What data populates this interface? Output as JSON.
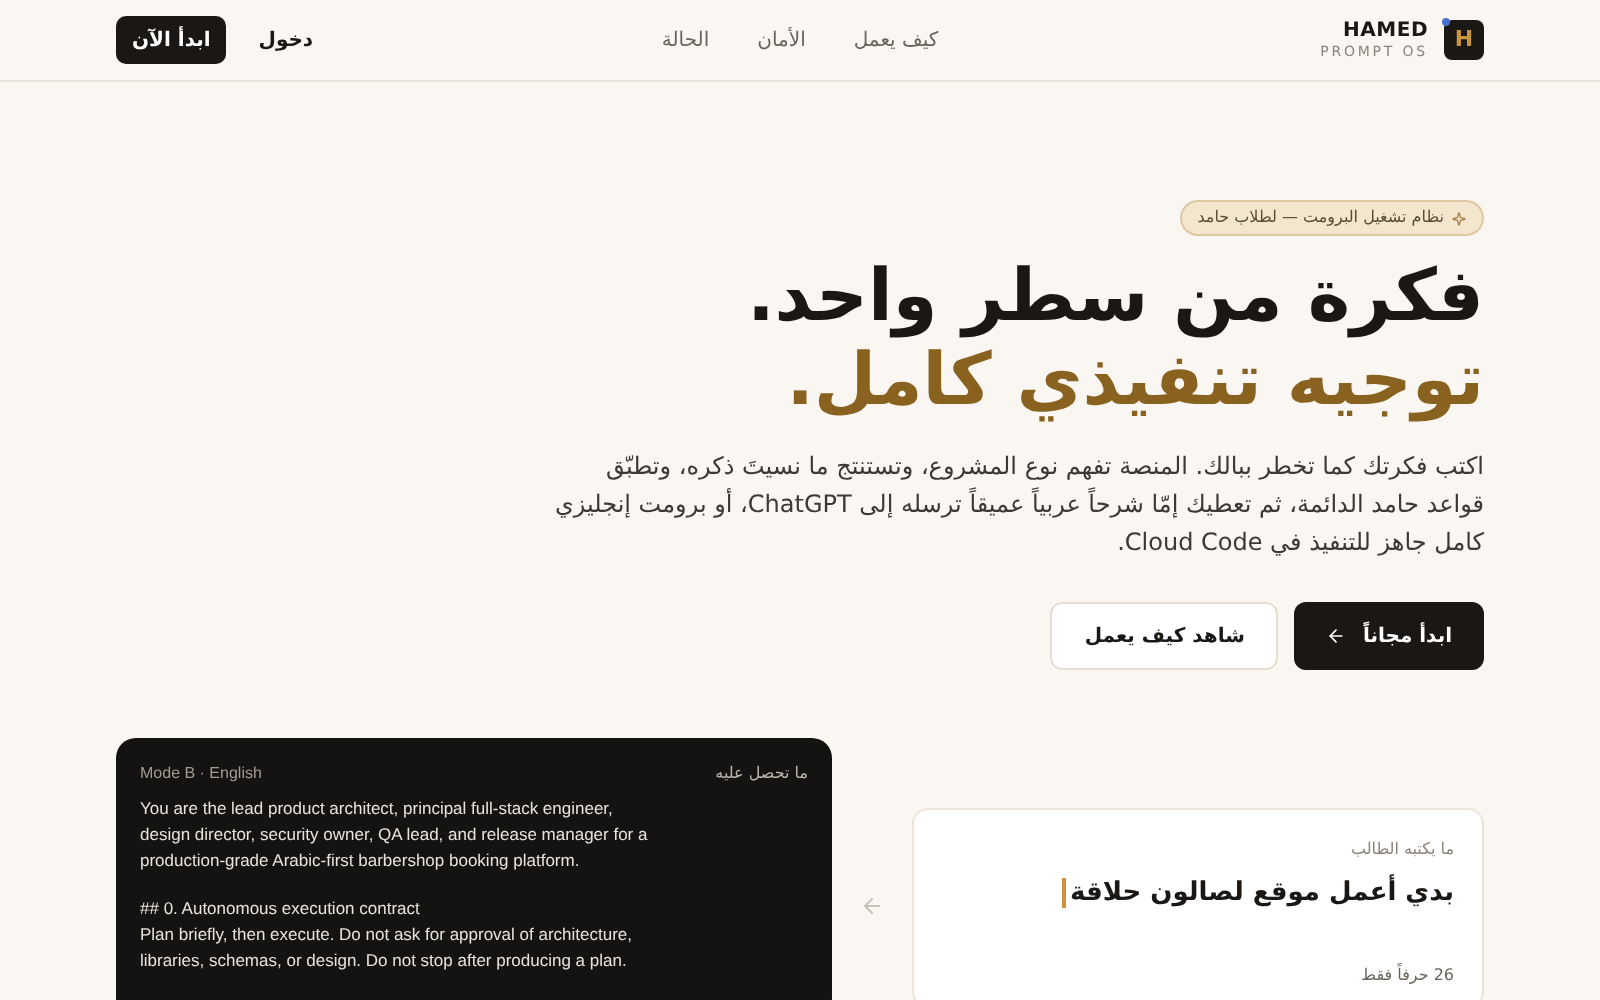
{
  "brand": {
    "letter": "H",
    "name": "HAMED",
    "tagline": "PROMPT OS"
  },
  "nav": [
    {
      "label": "كيف يعمل"
    },
    {
      "label": "الأمان"
    },
    {
      "label": "الحالة"
    }
  ],
  "header_actions": {
    "login": "دخول",
    "start": "ابدأ الآن"
  },
  "hero": {
    "badge": "نظام تشغيل البرومت — لطلاب حامد",
    "title_line_1": "فكرة من سطر واحد.",
    "title_line_2": "توجيه تنفيذي كامل.",
    "description": "اكتب فكرتك كما تخطر ببالك. المنصة تفهم نوع المشروع، وتستنتج ما نسيتَ ذكره، وتطبّق قواعد حامد الدائمة، ثم تعطيك إمّا شرحاً عربياً عميقاً ترسله إلى ChatGPT، أو برومت إنجليزي كامل جاهز للتنفيذ في Cloud Code.",
    "primary_button": "ابدأ مجاناً",
    "secondary_button": "شاهد كيف يعمل"
  },
  "output_card": {
    "label": "ما تحصل عليه",
    "mode": "Mode B · English",
    "blocks": [
      [
        "You are the lead product architect, principal full-stack engineer,",
        "design director, security owner, QA lead, and release manager for a",
        "production-grade Arabic-first barbershop booking platform."
      ],
      [
        "## 0. Autonomous execution contract",
        "Plan briefly, then execute. Do not ask for approval of architecture,",
        "libraries, schemas, or design. Do not stop after producing a plan."
      ]
    ]
  },
  "input_card": {
    "label": "ما يكتبه الطالب",
    "value": "بدي أعمل موقع لصالون حلاقة",
    "counter": "26 حرفاً فقط"
  }
}
